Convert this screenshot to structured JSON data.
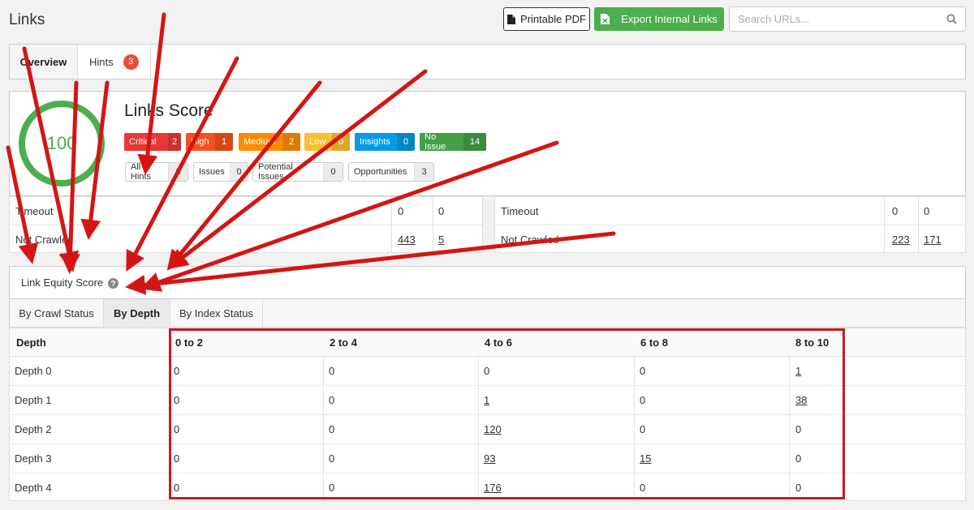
{
  "page": {
    "title": "Links"
  },
  "toolbar": {
    "pdf_label": "Printable PDF",
    "export_label": "Export Internal Links",
    "search_placeholder": "Search URLs..."
  },
  "tabs": {
    "overview": "Overview",
    "hints": "Hints",
    "hints_count": "3"
  },
  "score": {
    "value": "100",
    "title": "Links Score",
    "severities": [
      {
        "label": "Critical",
        "count": "2",
        "color": "#e53935"
      },
      {
        "label": "High",
        "count": "1",
        "color": "#f4511e"
      },
      {
        "label": "Medium",
        "count": "2",
        "color": "#fb8c00"
      },
      {
        "label": "Low",
        "count": "0",
        "color": "#fbc02d"
      },
      {
        "label": "Insights",
        "count": "0",
        "color": "#039be5"
      },
      {
        "label": "No Issue",
        "count": "14",
        "color": "#43a047"
      }
    ],
    "filters": [
      {
        "label": "All Hints",
        "count": "3"
      },
      {
        "label": "Issues",
        "count": "0"
      },
      {
        "label": "Potential Issues",
        "count": "0"
      },
      {
        "label": "Opportunities",
        "count": "3"
      }
    ]
  },
  "summary_left": {
    "rows": [
      {
        "label": "Timeout",
        "a": "0",
        "b": "0"
      },
      {
        "label": "Not Crawled",
        "a": "443",
        "b": "5"
      }
    ]
  },
  "summary_right": {
    "rows": [
      {
        "label": "Timeout",
        "a": "0",
        "b": "0"
      },
      {
        "label": "Not Crawled",
        "a": "223",
        "b": "171"
      }
    ]
  },
  "equity": {
    "title": "Link Equity Score",
    "subtabs": [
      "By Crawl Status",
      "By Depth",
      "By Index Status"
    ],
    "headers": [
      "Depth",
      "0 to 2",
      "2 to 4",
      "4 to 6",
      "6 to 8",
      "8 to 10"
    ],
    "rows": [
      [
        "Depth 0",
        "0",
        "0",
        "0",
        "0",
        "1"
      ],
      [
        "Depth 1",
        "0",
        "0",
        "1",
        "0",
        "38"
      ],
      [
        "Depth 2",
        "0",
        "0",
        "120",
        "0",
        "0"
      ],
      [
        "Depth 3",
        "0",
        "0",
        "93",
        "15",
        "0"
      ],
      [
        "Depth 4",
        "0",
        "0",
        "176",
        "0",
        "0"
      ]
    ]
  },
  "colors": {
    "accent_green": "#4cae4c",
    "annotation_red": "#c81c1c"
  }
}
